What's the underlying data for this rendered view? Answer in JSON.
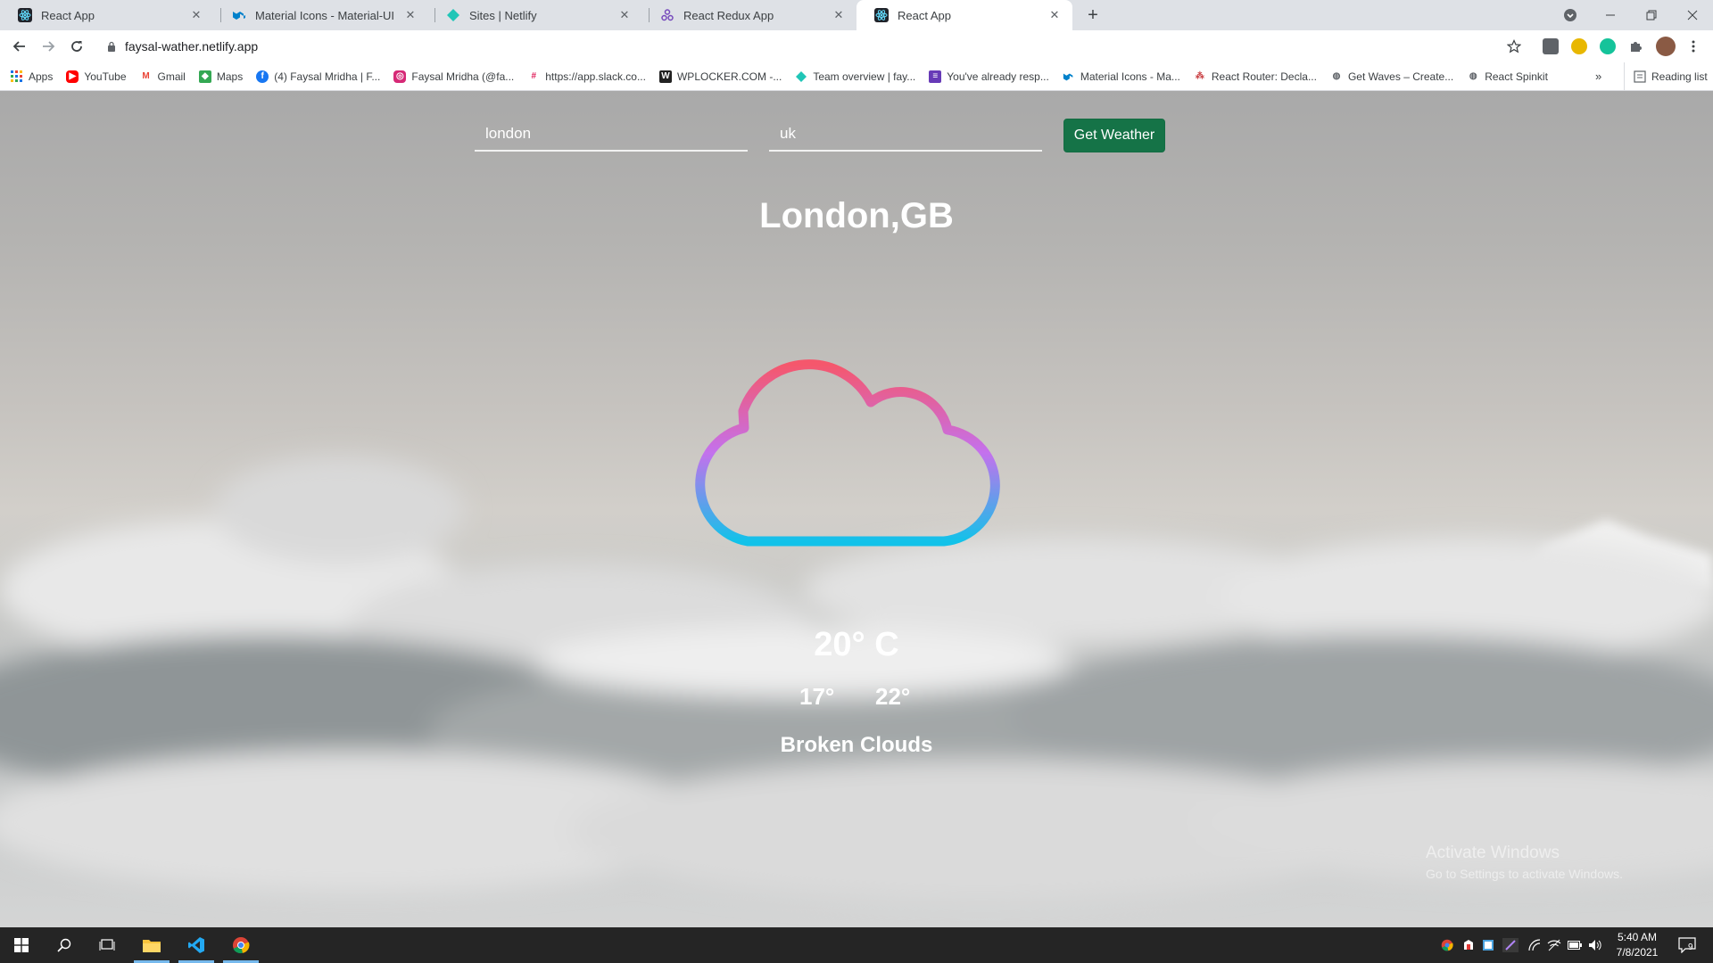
{
  "browser": {
    "tabs": [
      {
        "label": "React App",
        "icon": "react-icon",
        "active": false
      },
      {
        "label": "Material Icons - Material-UI",
        "icon": "material-ui-icon",
        "active": false
      },
      {
        "label": "Sites | Netlify",
        "icon": "netlify-icon",
        "active": false
      },
      {
        "label": "React Redux App",
        "icon": "redux-icon",
        "active": false
      },
      {
        "label": "React App",
        "icon": "react-icon",
        "active": true
      }
    ],
    "close_glyph": "✕",
    "new_tab_glyph": "+",
    "url": "faysal-wather.netlify.app",
    "bookmarks": [
      {
        "label": "Apps",
        "icon": "apps-grid-icon"
      },
      {
        "label": "YouTube",
        "icon": "youtube-icon"
      },
      {
        "label": "Gmail",
        "icon": "gmail-icon"
      },
      {
        "label": "Maps",
        "icon": "maps-icon"
      },
      {
        "label": "(4) Faysal Mridha | F...",
        "icon": "facebook-icon"
      },
      {
        "label": "Faysal Mridha (@fa...",
        "icon": "instagram-icon"
      },
      {
        "label": "https://app.slack.co...",
        "icon": "slack-icon"
      },
      {
        "label": "WPLOCKER.COM -...",
        "icon": "wplocker-icon"
      },
      {
        "label": "Team overview | fay...",
        "icon": "netlify-icon"
      },
      {
        "label": "You've already resp...",
        "icon": "forms-icon"
      },
      {
        "label": "Material Icons - Ma...",
        "icon": "material-ui-icon"
      },
      {
        "label": "React Router: Decla...",
        "icon": "react-router-icon"
      },
      {
        "label": "Get Waves – Create...",
        "icon": "globe-icon"
      },
      {
        "label": "React Spinkit",
        "icon": "globe-icon"
      }
    ],
    "more_glyph": "»",
    "reading_list": "Reading list"
  },
  "weather_app": {
    "city_input": "london",
    "country_input": "uk",
    "button_label": "Get Weather",
    "location": "London,GB",
    "temperature": "20° C",
    "min_temp": "17°",
    "max_temp": "22°",
    "description": "Broken Clouds",
    "icon": "cloud-icon",
    "icon_gradient": [
      "#f5576c",
      "#c471ed",
      "#12c2e9"
    ]
  },
  "os": {
    "watermark_title": "Activate Windows",
    "watermark_subtitle": "Go to Settings to activate Windows.",
    "time": "5:40 AM",
    "date": "7/8/2021",
    "notification_count": "9"
  },
  "colors": {
    "button": "#157347",
    "taskbar": "#252525",
    "tab_strip": "#dee1e6"
  }
}
